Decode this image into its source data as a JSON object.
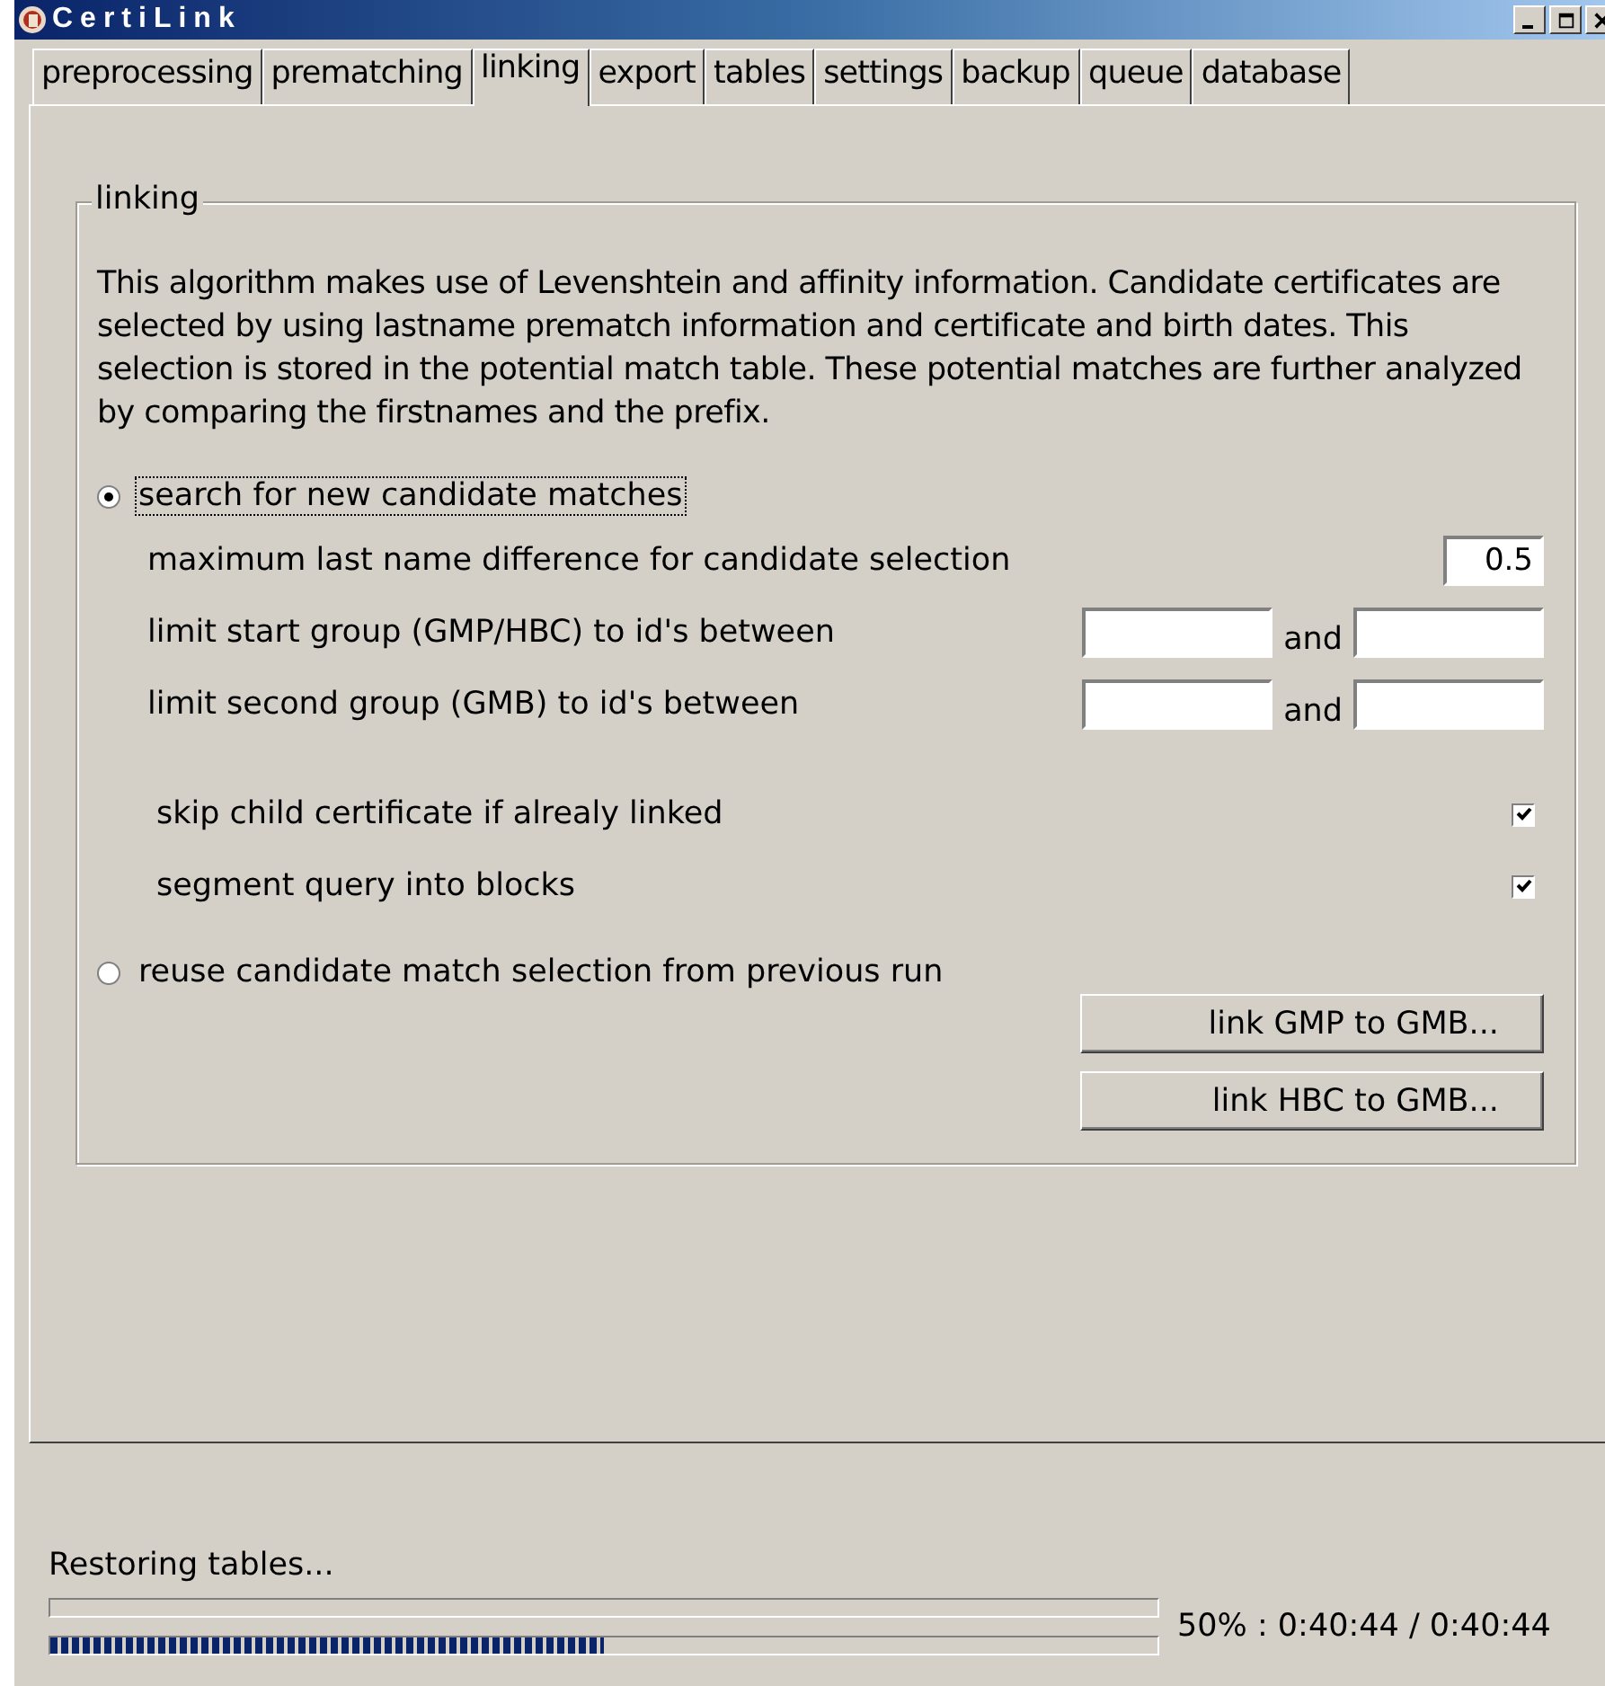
{
  "window": {
    "title": "CertiLink"
  },
  "tabs": [
    {
      "label": "preprocessing",
      "selected": false
    },
    {
      "label": "prematching",
      "selected": false
    },
    {
      "label": "linking",
      "selected": true
    },
    {
      "label": "export",
      "selected": false
    },
    {
      "label": "tables",
      "selected": false
    },
    {
      "label": "settings",
      "selected": false
    },
    {
      "label": "backup",
      "selected": false
    },
    {
      "label": "queue",
      "selected": false
    },
    {
      "label": "database",
      "selected": false
    }
  ],
  "group": {
    "title": "linking",
    "description": "This algorithm makes use of Levenshtein and affinity information. Candidate certificates are selected by using lastname prematch information and certificate and birth dates. This selection is stored in the potential match table. These potential matches are further analyzed by comparing the firstnames and the prefix.",
    "modes": [
      {
        "label": "search for new candidate matches",
        "selected": true,
        "focused": true
      },
      {
        "label": "reuse candidate match selection from previous run",
        "selected": false,
        "focused": false
      }
    ],
    "settings": [
      {
        "kind": "single",
        "label": "maximum last name difference for candidate selection",
        "value": "0.5"
      },
      {
        "kind": "range",
        "label": "limit start group (GMP/HBC) to id's between",
        "joiner": "and"
      },
      {
        "kind": "range",
        "label": "limit second group (GMB) to id's between",
        "joiner": "and"
      },
      {
        "kind": "check",
        "label": "skip child certificate if alrealy linked",
        "checked": true
      },
      {
        "kind": "check",
        "label": "segment query into blocks",
        "checked": true
      }
    ],
    "buttons": [
      "link GMP to GMB...",
      "link HBC to GMB..."
    ]
  },
  "status": {
    "message": "Restoring tables...",
    "bars": [
      {
        "level": 0
      },
      {
        "level": 0.5
      }
    ],
    "progress_text": "50% : 0:40:44 / 0:40:44"
  }
}
